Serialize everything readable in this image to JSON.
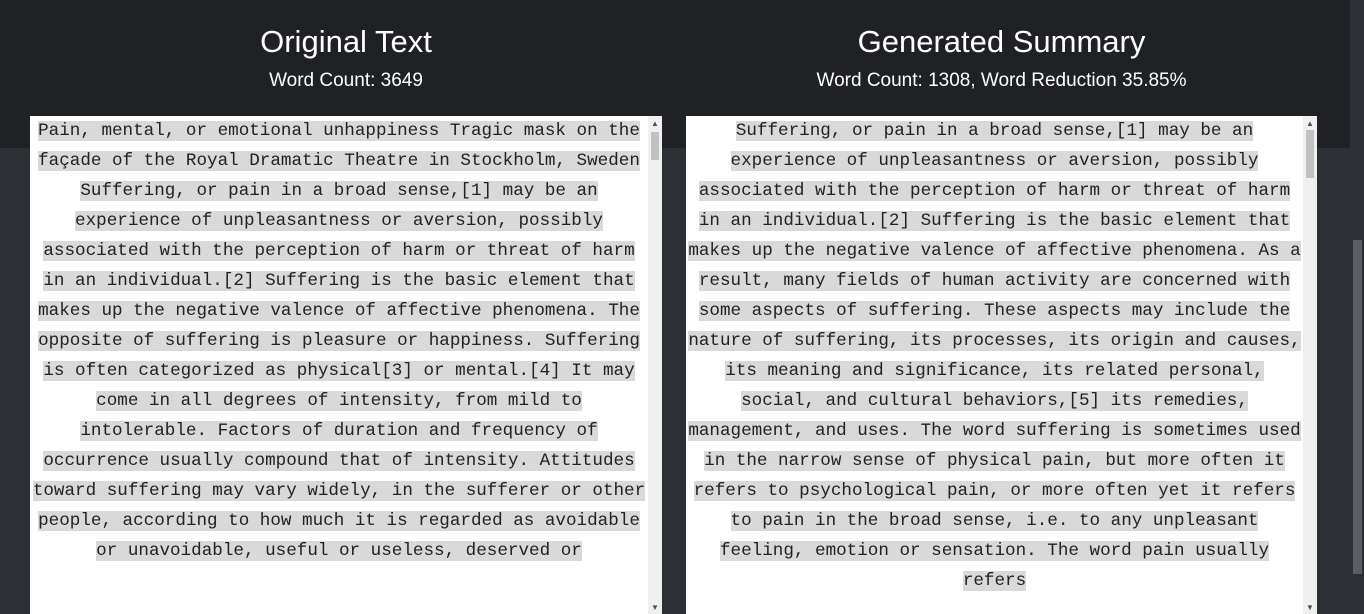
{
  "original": {
    "title": "Original Text",
    "word_count_label": "Word Count: 3649",
    "text": "Pain, mental, or emotional unhappiness Tragic mask on the façade of the Royal Dramatic Theatre in Stockholm, Sweden Suffering, or pain in a broad sense,[1] may be an experience of unpleasantness or aversion, possibly associated with the perception of harm or threat of harm in an individual.[2] Suffering is the basic element that makes up the negative valence of affective phenomena. The opposite of suffering is pleasure or happiness. Suffering is often categorized as physical[3] or mental.[4] It may come in all degrees of intensity, from mild to intolerable. Factors of duration and frequency of occurrence usually compound that of intensity. Attitudes toward suffering may vary widely, in the sufferer or other people, according to how much it is regarded as avoidable or unavoidable, useful or useless, deserved or"
  },
  "summary": {
    "title": "Generated Summary",
    "word_count_label": "Word Count: 1308, Word Reduction 35.85%",
    "text": "Suffering, or pain in a broad sense,[1] may be an experience of unpleasantness or aversion, possibly associated with the perception of harm or threat of harm in an individual.[2] Suffering is the basic element that makes up the negative valence of affective phenomena. As a result, many fields of human activity are concerned with some aspects of suffering. These aspects may include the nature of suffering, its processes, its origin and causes, its meaning and significance, its related personal, social, and cultural behaviors,[5] its remedies, management, and uses. The word suffering is sometimes used in the narrow sense of physical pain, but more often it refers to psychological pain, or more often yet it refers to pain in the broad sense, i.e. to any unpleasant feeling, emotion or sensation. The word pain usually refers"
  },
  "colors": {
    "background_top": "#1f2124",
    "background_bottom": "#2b2e32",
    "text_highlight": "#d9d9d9",
    "heading_text": "#ffffff"
  }
}
